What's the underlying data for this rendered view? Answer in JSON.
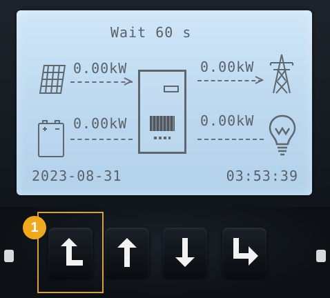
{
  "lcd": {
    "status": "Wait  60 s",
    "pv_power": "0.00kW",
    "battery_power": "0.00kW",
    "grid_power": "0.00kW",
    "load_power": "0.00kW",
    "date": "2023-08-31",
    "time": "03:53:39",
    "icons": [
      "solar-panel-icon",
      "battery-icon",
      "inverter-icon",
      "grid-tower-icon",
      "light-bulb-icon"
    ]
  },
  "keypad": {
    "callout_number": "1",
    "buttons": [
      "return-key",
      "up-key",
      "down-key",
      "enter-key"
    ],
    "highlight_color": "#d9a233",
    "badge_color": "#f0a81e"
  }
}
